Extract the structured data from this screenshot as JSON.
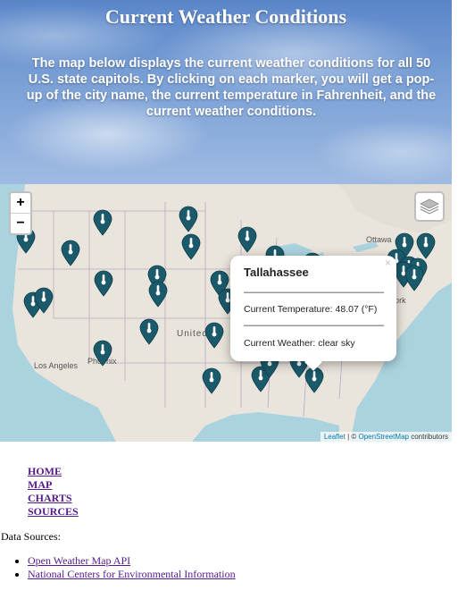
{
  "header": {
    "title": "Current Weather Conditions",
    "description": "The map below displays the current weather conditions for all 50 U.S. state capitols. By clicking on each marker, you will get a pop-up of the city name, the current temperature in Fahrenheit, and the current weather conditions."
  },
  "map": {
    "zoom_in": "+",
    "zoom_out": "−",
    "labels": {
      "ottawa": "Ottawa",
      "york": "York",
      "united": "United",
      "los_angeles": "Los Angeles",
      "phoenix": "Phoenix"
    },
    "popup": {
      "close": "×",
      "city": "Tallahassee",
      "temperature": "Current Temperature: 48.07 (°F)",
      "weather": "Current Weather: clear sky"
    },
    "attribution": {
      "leaflet": "Leaflet",
      "sep": " | © ",
      "osm": "OpenStreetMap",
      "suffix": " contributors"
    },
    "marker_color": "#1b5a6b",
    "marker_icon": "thermometer-icon"
  },
  "nav": {
    "home": "HOME",
    "map": "MAP",
    "charts": "CHARTS",
    "sources": "SOURCES"
  },
  "sources": {
    "label": "Data Sources:",
    "items": [
      "Open Weather Map API",
      "National Centers for Environmental Information"
    ]
  }
}
